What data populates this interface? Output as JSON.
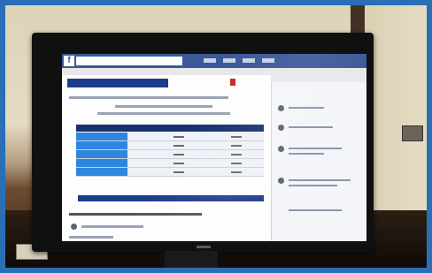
{
  "photo": {
    "description_icons": [
      "monitor-icon"
    ],
    "colors": {
      "frame": "#2a6fb5",
      "facebook_blue": "#3b5998",
      "table_header": "#16316e",
      "table_accent": "#2f86de"
    }
  },
  "screen": {
    "header_logo": "f"
  }
}
